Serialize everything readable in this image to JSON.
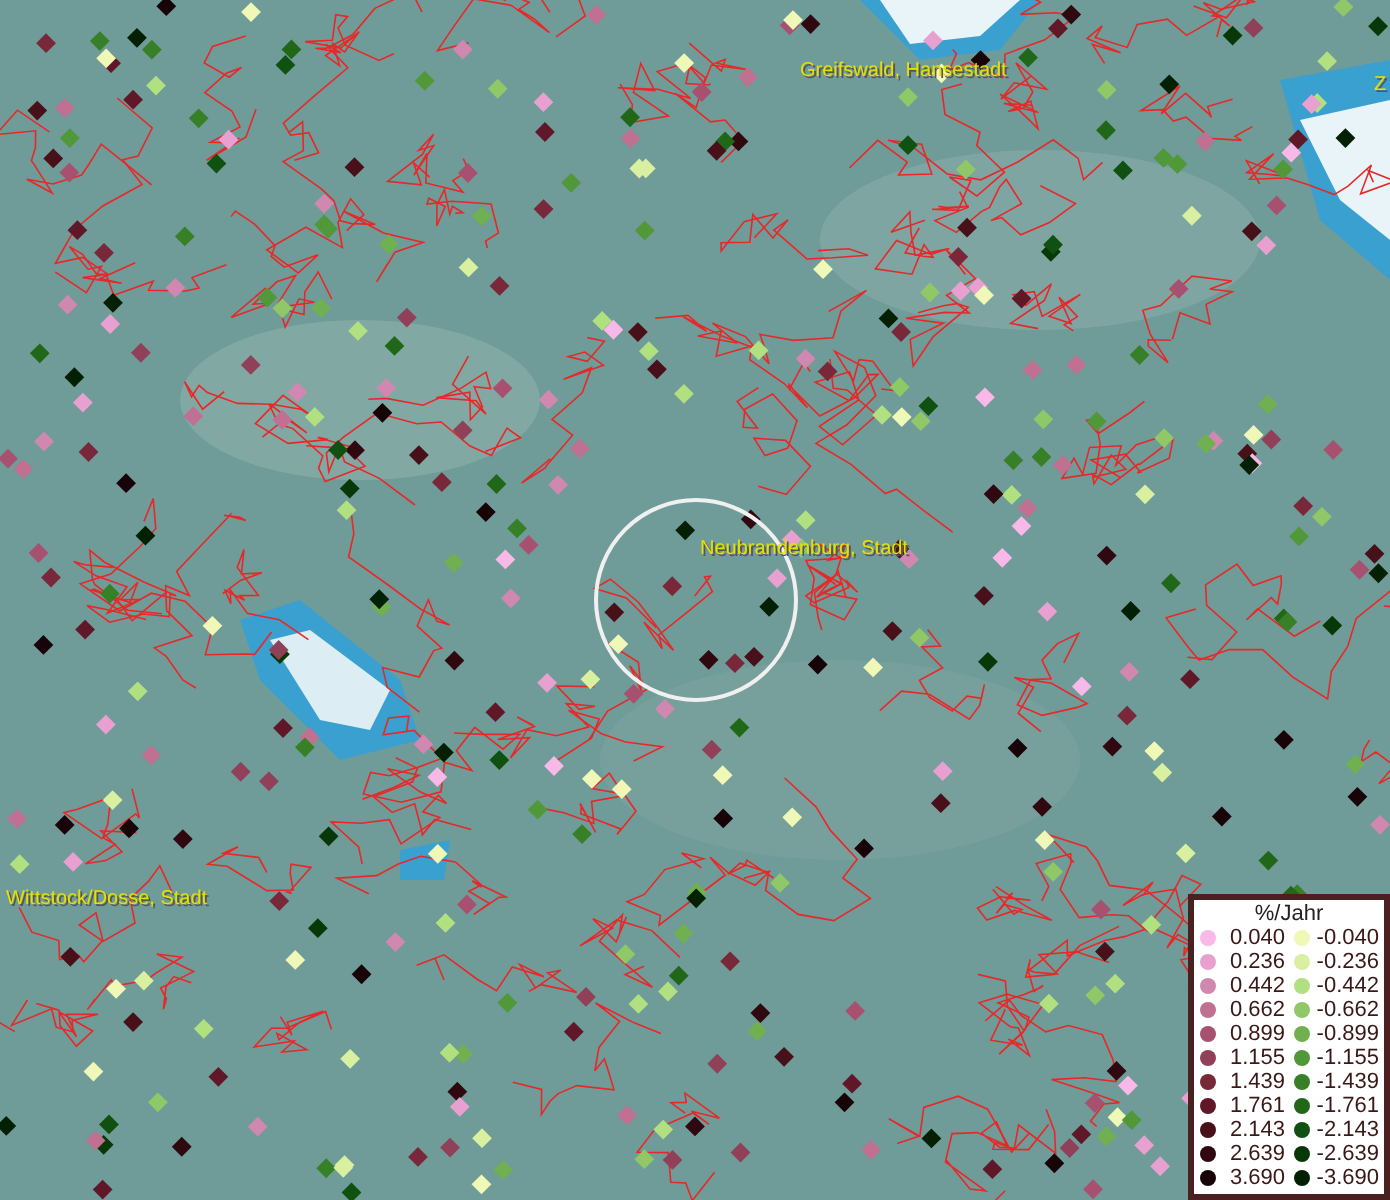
{
  "map": {
    "labels": [
      {
        "text": "Greifswald, Hansestadt",
        "kind": "city"
      },
      {
        "text": "Z",
        "kind": "city"
      },
      {
        "text": "Neubrandenburg, Stadt",
        "kind": "city"
      },
      {
        "text": "Wittstock/Dosse, Stadt",
        "kind": "city"
      }
    ]
  },
  "legend": {
    "title": "%/Jahr",
    "rows": [
      {
        "positive": {
          "value": "0.040",
          "color": "#f8b8e8"
        },
        "negative": {
          "value": "-0.040",
          "color": "#f0f8b8"
        }
      },
      {
        "positive": {
          "value": "0.236",
          "color": "#e8a0d0"
        },
        "negative": {
          "value": "-0.236",
          "color": "#d8f0a0"
        }
      },
      {
        "positive": {
          "value": "0.442",
          "color": "#d088b0"
        },
        "negative": {
          "value": "-0.442",
          "color": "#b0e080"
        }
      },
      {
        "positive": {
          "value": "0.662",
          "color": "#c07090"
        },
        "negative": {
          "value": "-0.662",
          "color": "#90c868"
        }
      },
      {
        "positive": {
          "value": "0.899",
          "color": "#a85070"
        },
        "negative": {
          "value": "-0.899",
          "color": "#70b050"
        }
      },
      {
        "positive": {
          "value": "1.155",
          "color": "#904058"
        },
        "negative": {
          "value": "-1.155",
          "color": "#509838"
        }
      },
      {
        "positive": {
          "value": "1.439",
          "color": "#782838"
        },
        "negative": {
          "value": "-1.439",
          "color": "#388028"
        }
      },
      {
        "positive": {
          "value": "1.761",
          "color": "#601828"
        },
        "negative": {
          "value": "-1.761",
          "color": "#206818"
        }
      },
      {
        "positive": {
          "value": "2.143",
          "color": "#481018"
        },
        "negative": {
          "value": "-2.143",
          "color": "#105010"
        }
      },
      {
        "positive": {
          "value": "2.639",
          "color": "#300810"
        },
        "negative": {
          "value": "-2.639",
          "color": "#083808"
        }
      },
      {
        "positive": {
          "value": "3.690",
          "color": "#180408"
        },
        "negative": {
          "value": "-3.690",
          "color": "#042004"
        }
      }
    ]
  }
}
